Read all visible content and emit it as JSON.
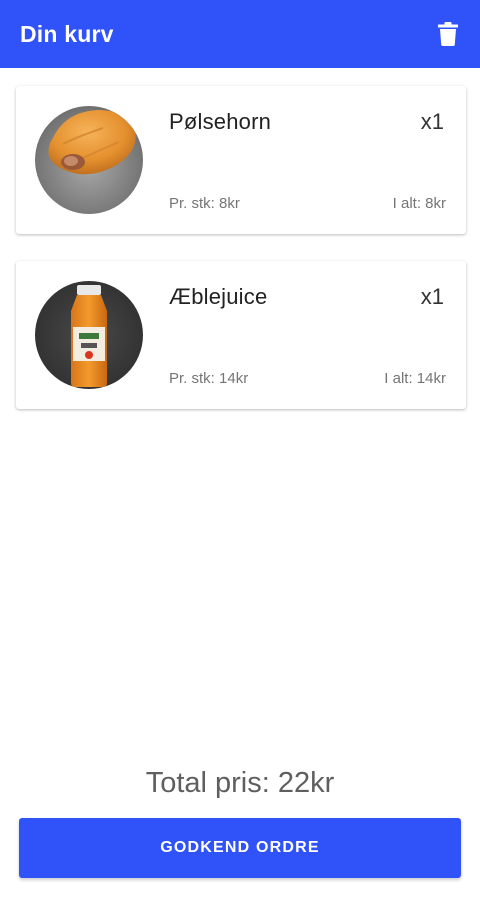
{
  "appbar": {
    "title": "Din kurv",
    "background_color": "#3052f9",
    "action_icon": "trash-icon"
  },
  "cart": {
    "items": [
      {
        "name": "Pølsehorn",
        "quantity": "x1",
        "unit_price": "Pr. stk: 8kr",
        "line_total": "I alt: 8kr",
        "image": "sausage-roll-photo"
      },
      {
        "name": "Æblejuice",
        "quantity": "x1",
        "unit_price": "Pr. stk: 14kr",
        "line_total": "I alt: 14kr",
        "image": "apple-juice-bottle-photo"
      }
    ]
  },
  "footer": {
    "total": "Total pris: 22kr",
    "approve_label": "GODKEND ORDRE",
    "button_color": "#3052f9"
  }
}
